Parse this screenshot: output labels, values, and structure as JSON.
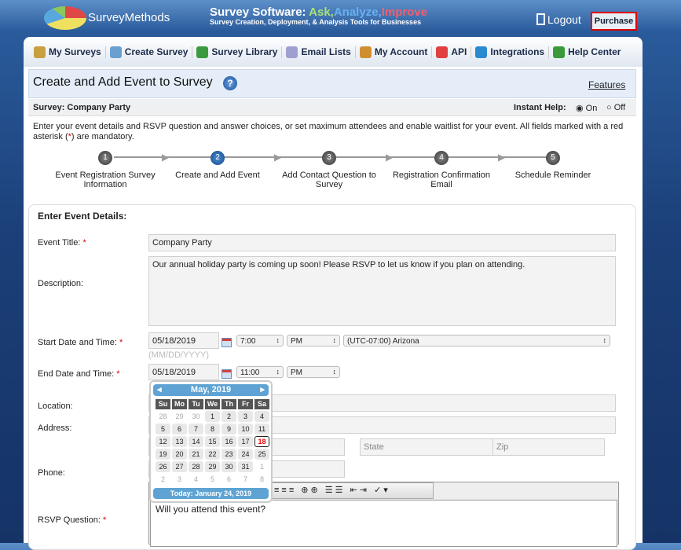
{
  "header": {
    "brand": "SurveyMethods",
    "tagline_prefix": "Survey Software: ",
    "tagline_ask": "Ask,",
    "tagline_analyze": "Analyze,",
    "tagline_improve": "Improve",
    "subtitle": "Survey Creation, Deployment, & Analysis Tools for Businesses",
    "logout": "Logout",
    "purchase": "Purchase",
    "colors": {
      "ask": "#a8e07a",
      "analyze": "#6ab0f0",
      "improve": "#f06070",
      "purchase_border": "#dd0000"
    }
  },
  "nav": [
    {
      "label": "My Surveys",
      "icon": "user-doc-icon"
    },
    {
      "label": "Create Survey",
      "icon": "checklist-icon"
    },
    {
      "label": "Survey Library",
      "icon": "books-icon"
    },
    {
      "label": "Email Lists",
      "icon": "envelope-icon"
    },
    {
      "label": "My Account",
      "icon": "person-icon"
    },
    {
      "label": "API",
      "icon": "puzzle-icon"
    },
    {
      "label": "Integrations",
      "icon": "sync-icon"
    },
    {
      "label": "Help Center",
      "icon": "help-icon"
    }
  ],
  "page": {
    "title": "Create and Add Event to Survey",
    "features": "Features",
    "survey_label": "Survey: Company Party",
    "instant_help": "Instant Help:",
    "on": "On",
    "off": "Off",
    "intro_a": "Enter your event details and RSVP question and answer choices, or set maximum attendees and enable waitlist for your event. All fields marked with a red asterisk (",
    "intro_star": "*",
    "intro_b": ") are mandatory."
  },
  "steps": [
    {
      "n": "1",
      "label": "Event Registration Survey Information"
    },
    {
      "n": "2",
      "label": "Create and Add Event"
    },
    {
      "n": "3",
      "label": "Add Contact Question to Survey"
    },
    {
      "n": "4",
      "label": "Registration Confirmation Email"
    },
    {
      "n": "5",
      "label": "Schedule Reminder"
    }
  ],
  "form": {
    "section": "Enter Event Details:",
    "star": "*",
    "event_title_label": "Event Title:",
    "event_title": "Company Party",
    "description_label": "Description:",
    "description": "Our annual holiday party is coming up soon! Please RSVP to let us know if you plan on attending.",
    "start_label": "Start Date and Time:",
    "start_date": "05/18/2019",
    "start_time": "7:00",
    "start_ampm": "PM",
    "timezone": "(UTC-07:00) Arizona",
    "date_hint": "(MM/DD/YYYY)",
    "end_label": "End Date and Time:",
    "end_date": "05/18/2019",
    "end_time": "11:00",
    "end_ampm": "PM",
    "location_label": "Location:",
    "address_label": "Address:",
    "state_placeholder": "State",
    "zip_placeholder": "Zip",
    "phone_label": "Phone:",
    "rsvp_label": "RSVP Question:",
    "rsvp_value": "Will you attend this event?"
  },
  "calendar": {
    "month": "May, 2019",
    "days": [
      "Su",
      "Mo",
      "Tu",
      "We",
      "Th",
      "Fr",
      "Sa"
    ],
    "dates": [
      "28",
      "29",
      "30",
      "1",
      "2",
      "3",
      "4",
      "5",
      "6",
      "7",
      "8",
      "9",
      "10",
      "11",
      "12",
      "13",
      "14",
      "15",
      "16",
      "17",
      "18",
      "19",
      "20",
      "21",
      "22",
      "23",
      "24",
      "25",
      "26",
      "27",
      "28",
      "29",
      "30",
      "31",
      "1",
      "2",
      "3",
      "4",
      "5",
      "6",
      "7",
      "8"
    ],
    "selected": "18",
    "today": "Today: January 24, 2019"
  }
}
